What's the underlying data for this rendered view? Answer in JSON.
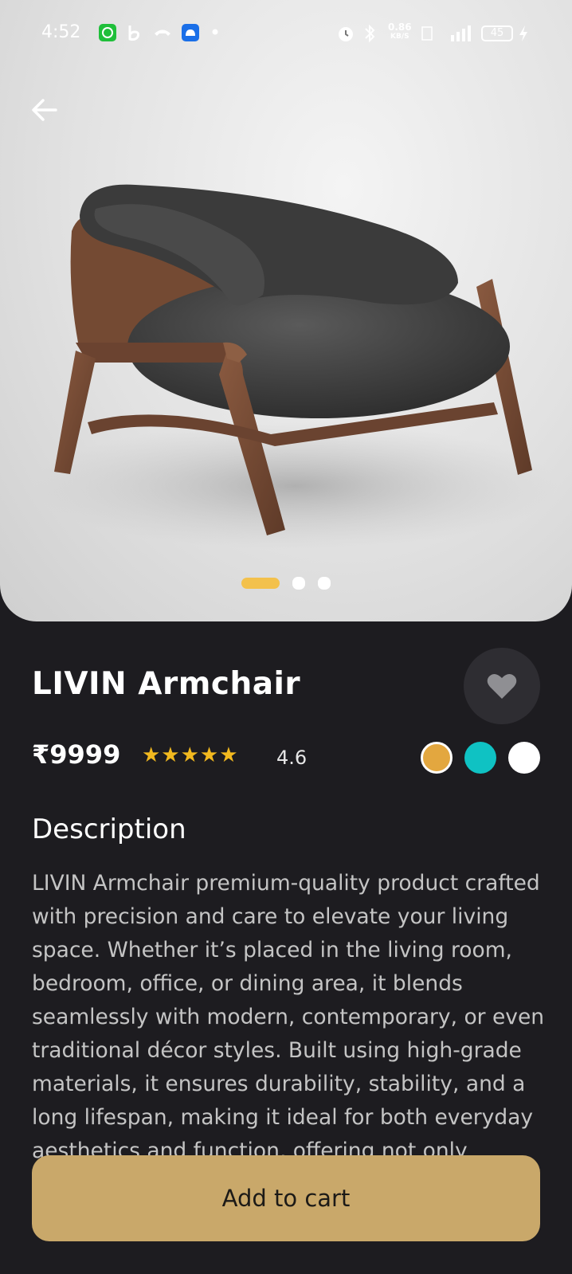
{
  "status_bar": {
    "time": "4:52",
    "net_speed": "0.86",
    "net_unit": "KB/S",
    "battery": "45"
  },
  "product": {
    "name": "LIVIN Armchair",
    "price": "₹9999",
    "stars": "★★★★★",
    "rating": "4.6",
    "colors": [
      "#e3a73f",
      "#0fc2c3",
      "#ffffff"
    ],
    "carousel": {
      "total": 3,
      "active": 0,
      "active_color": "#f3c14c"
    }
  },
  "description": {
    "heading": "Description",
    "text": "LIVIN Armchair premium-quality product crafted with precision and care to elevate your living space. Whether it’s placed in the living room, bedroom, office, or dining area, it blends seamlessly with modern, contemporary, or even traditional décor styles. Built using high-grade materials, it ensures durability, stability, and a long lifespan, making it ideal for both everyday aesthetics and function, offering not only"
  },
  "actions": {
    "add_to_cart": "Add to cart"
  },
  "theme": {
    "background": "#1d1c20",
    "accent": "#c9a86a",
    "star": "#f2b91f"
  }
}
